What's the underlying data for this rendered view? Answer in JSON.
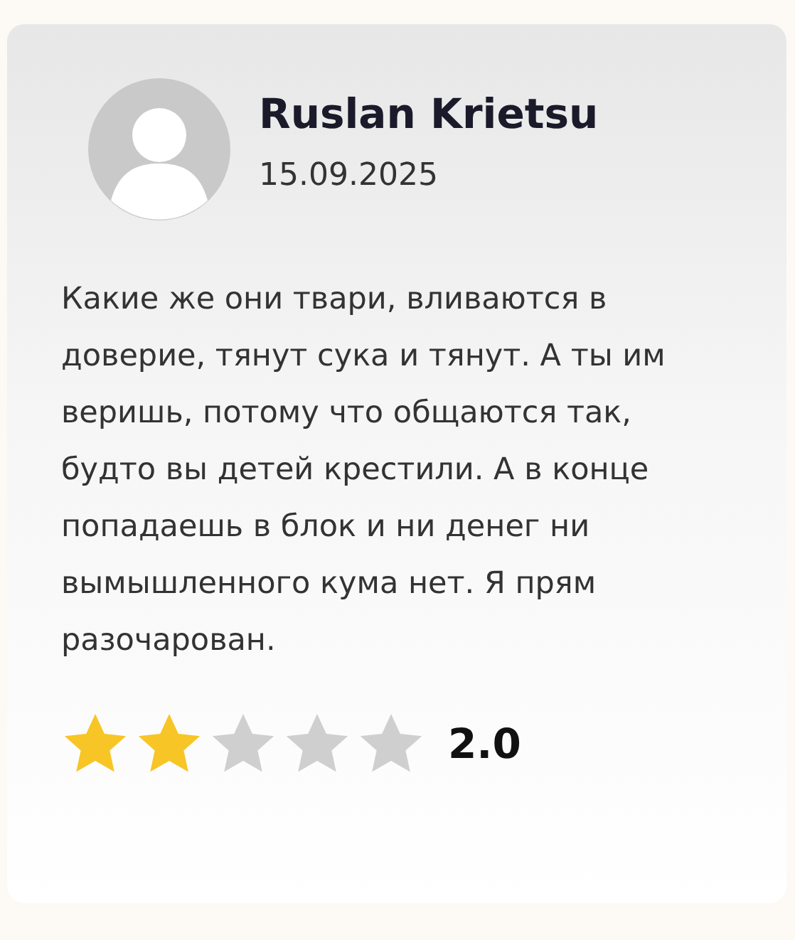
{
  "review": {
    "author": "Ruslan Krietsu",
    "date": "15.09.2025",
    "text": "Какие же они твари, вливаются в доверие, тянут сука и тянут. А ты им веришь, потому что общаются так, будто вы детей крестили. А в конце попадаешь в блок и ни денег ни вымышленного кума нет. Я прям разочарован.",
    "stars": 2,
    "rating": "2.0"
  }
}
